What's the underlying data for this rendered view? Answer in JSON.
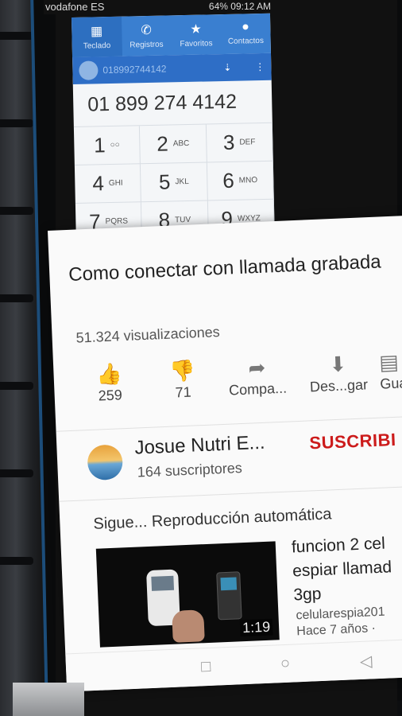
{
  "status_bar": {
    "carrier": "vodafone ES",
    "battery": "64%",
    "time": "09:12 AM"
  },
  "dialer": {
    "tabs": [
      {
        "label": "Teclado",
        "icon": "keypad-icon"
      },
      {
        "label": "Registros",
        "icon": "call-log-icon"
      },
      {
        "label": "Favoritos",
        "icon": "star-icon"
      },
      {
        "label": "Contactos",
        "icon": "person-icon"
      }
    ],
    "contact_number": "01899274414​2",
    "number": "01 899 274 4142",
    "keys": [
      {
        "digit": "1",
        "letters": ""
      },
      {
        "digit": "2",
        "letters": "ABC"
      },
      {
        "digit": "3",
        "letters": "DEF"
      },
      {
        "digit": "4",
        "letters": "GHI"
      },
      {
        "digit": "5",
        "letters": "JKL"
      },
      {
        "digit": "6",
        "letters": "MNO"
      },
      {
        "digit": "7",
        "letters": "PQRS"
      },
      {
        "digit": "8",
        "letters": "TUV"
      },
      {
        "digit": "9",
        "letters": "WXYZ"
      }
    ]
  },
  "video": {
    "title": "Como conectar con llamada grabada",
    "views": "51.324 visualizaciones",
    "likes": "259",
    "dislikes": "71",
    "share_label": "Compa...",
    "download_label": "Des...gar",
    "save_label": "Gua"
  },
  "channel": {
    "name": "Josue Nutri E...",
    "subscribers": "164 suscriptores",
    "subscribe_label": "SUSCRIBI"
  },
  "up_next": {
    "label": "Sigue... Reproducción automática",
    "video": {
      "title": "funcion 2 cel\nespiar llamad\n3gp",
      "channel": "celularespia201",
      "age": "Hace 7 años ·",
      "duration": "1:19"
    }
  },
  "colors": {
    "accent_blue": "#3a7fd0",
    "subscribe_red": "#cc1b1b"
  }
}
